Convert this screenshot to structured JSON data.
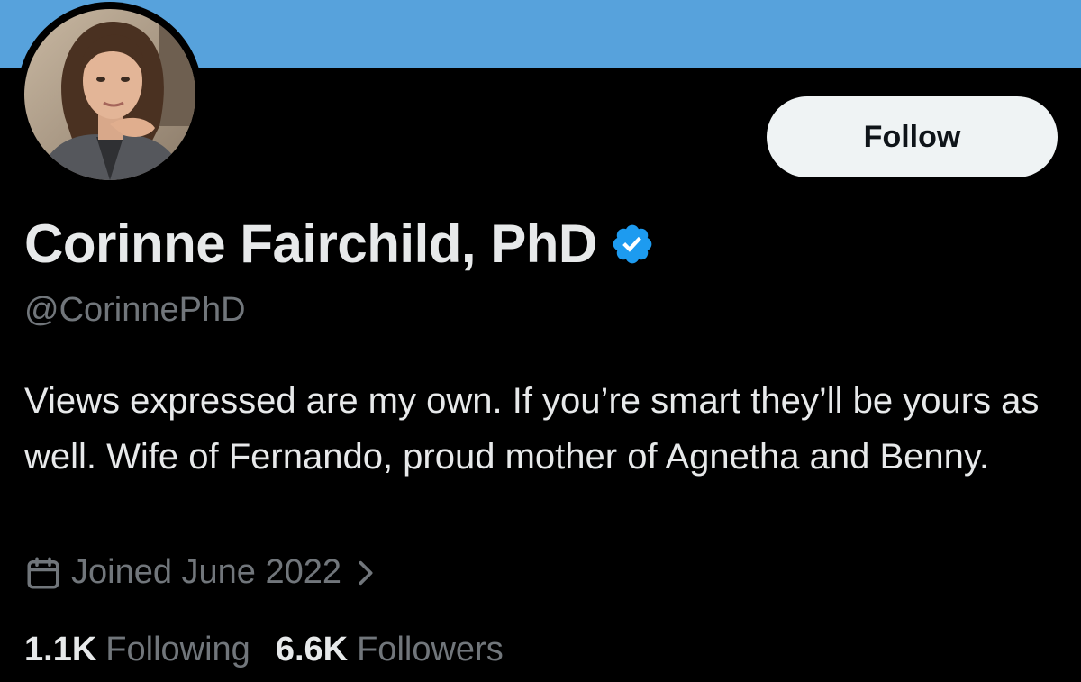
{
  "profile": {
    "name": "Corinne Fairchild, PhD",
    "handle": "@CorinnePhD",
    "verified_icon": "verified-badge",
    "bio": "Views expressed are my own. If you’re smart they’ll be yours as well. Wife of Fernando, proud mother of Agnetha and Benny.",
    "joined": "Joined June 2022",
    "joined_icon": "calendar-icon",
    "following_count": "1.1K",
    "following_label": "Following",
    "followers_count": "6.6K",
    "followers_label": "Followers"
  },
  "actions": {
    "follow_label": "Follow"
  },
  "colors": {
    "banner": "#57a2dc",
    "background": "#000000",
    "primary_text": "#e7e9ea",
    "secondary_text": "#71767b",
    "verified": "#1d9bf0",
    "button_bg": "#eff3f4"
  }
}
